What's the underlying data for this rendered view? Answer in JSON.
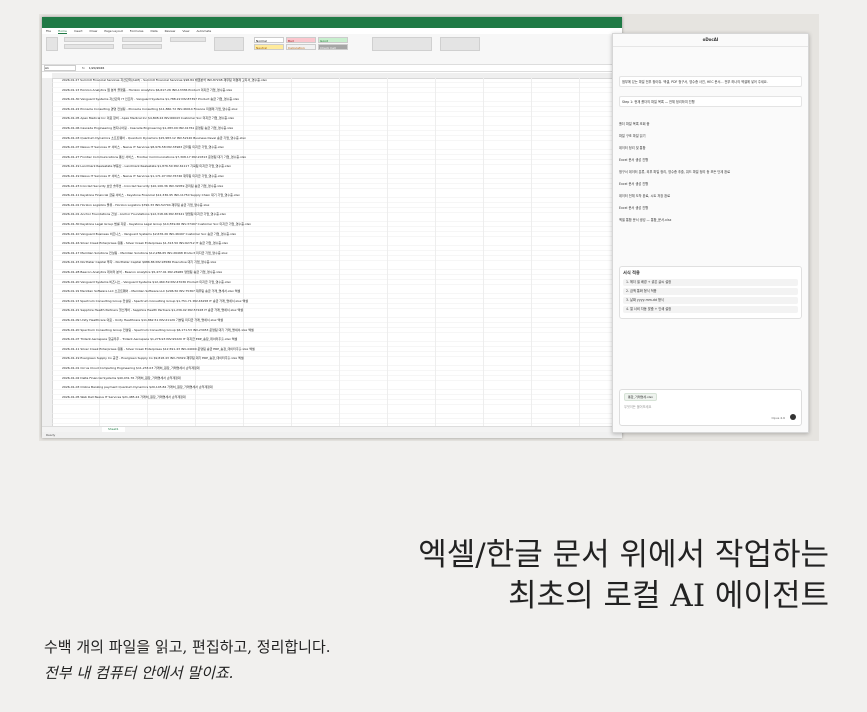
{
  "excel": {
    "ribbon_tabs": [
      "File",
      "Home",
      "Insert",
      "Draw",
      "Page Layout",
      "Formulas",
      "Data",
      "Review",
      "View",
      "Automate"
    ],
    "active_tab": "Home",
    "share_label": "Share",
    "comments_label": "Comments",
    "style_cells": [
      "Normal",
      "Bad",
      "Good",
      "Neutral",
      "Calculation",
      "Check Cell"
    ],
    "namebox": "A1",
    "formula_value": "1/20/2026",
    "sheet_tab": "Sheet1",
    "status": "Ready",
    "rows": [
      "2026.01.27   Summit Financial Services   자산관리(ALM) - Summit Financial Services   $98.84   채권분석   INV-87248   재무팀   미결제   고지서_영수증.xlsx",
      "2026.01.13   Horizon Analytics   웹 분석   플랫폼 - Horizon Analytics   $6,617.26   INV-13336   Product   미지급   기업_영수증.xlsx",
      "2026-01-30 Vanguard Systems   자산관리   IT 인프라 - Vanguard Systems   $1,788.22   INV-87397   Product   송금   기업_영수증.xlsx",
      "2026-01-22 Pinnacle Consulting   경영 컨설팅 - Pinnacle Consulting   $11,860.72   INV-46014   Finance   미결제   기업_영수증.xlsx",
      "2026-01-05 Apex Medical Inc   의료 장비 - Apex Medical Inc   $4,808.24   INV-66043   Customer Svc   미지급   기업_영수증.xlsx",
      "2026-01-06 Cascade Engineering   엔지니어링 - Cascade Engineering   $1,283.09   INV-41761   운영팀   송금   기업_영수증.xlsx",
      "2026-01-03 Quantum Dynamics   소프트웨어 - Quantum Dynamics   $15,983.12   INV-52120   Business Devel   송금   기업_영수증.xlsx",
      "2026-01-07 Nexus IT Services   IT 서비스 - Nexus IT Services   $8,976.58   INV-33963   관리팀   미지급   기업_영수증.xlsx",
      "2026-01-27 Frontier Communications   통신 서비스 - Frontier Communications   $7,308.17   INV-20313   운영팀   대기   기업_영수증.xlsx",
      "2026-01-19 Landmark Realestate   부동산 - Landmark Realestate   $1,876.50   INV-61117   기획팀   미지급   기업_영수증.xlsx",
      "2026-01-19 Nexus IT Services   IT 서비스 - Nexus IT Services   $1,171.97   INV-76746   재무팀   미지급   기업_영수증.xlsx",
      "2026-01-23 Ironclad Security   보안 솔루션 - Ironclad Security   $10,106.36   INV-32059   관리팀   송금   기업_영수증.xlsx",
      "2026-01-11 Keystone Financial   금융 서비스 - Keystone Financial   $12,336.95   INV-11750   Supply Chain   대기   기업_영수증.xlsx",
      "2026-01-01 Horizon Logistics   물류 - Horizon Logistics   $790.33   INV-52794   재무팀   송금   기업_영수증.xlsx",
      "2026-01-01 Anchor Foundations   건설 - Anchor Foundations   $12,318.96   INV-87441   영업팀   미지급   기업_영수증.xlsx",
      "2026-01-30 Keystone Legal Group   법률 자문 - Keystone Legal Group   $14,559.66   INV-37497   Customer Svc   미지급   기업_영수증.xlsx",
      "2026-01-10 Vanguard Business   비즈니스 - Vanguard Systems   $2,676.26   INV-46497   Customer Svc   송금   기업_영수증.xlsx",
      "2026-01-16 Silver Creek Enterprises   유통 - Silver Creek Enterprises   $1,313.50   INV-62712   IT   송금   기업_영수증.xlsx",
      "2026-01-17 Meridian Solutions   컨설팅 - Meridian Solutions   $12,286.65   INV-26468   Product   미지급   기업_영수증.xlsx",
      "2026-01-15 Northstar Capital   투자 - Northstar Capital   $686.86   INV-93586   Executive   대기   기업_영수증.xlsx",
      "2026-01-28 Beacon Analytics   데이터 분석 - Beacon Analytics   $5,477.91   INV-26965   영업팀   송금   기업_영수증.xlsx",
      "2026-01-20 Vanguard Systems   비즈니스 - Vanguard Systems   $12,460.59   INV-47036   Product   미지급   기업_영수증.xlsx",
      "2026.01.19   Meridian Software LLC   소프트웨어 - Meridian Software LLC   $296.50   INV-75367   재무팀   송금   거래_명세서.xlsx   엑셀",
      "2026.01.13   Spectrum Consulting Group   컨설팅 - Spectrum Consulting Group   $1,751.71   INV-46158   IT   송금   거래_명세서.xlsx   엑셀",
      "2026-01-21 Sapphire Health Partners   헬스케어 - Sapphire Health Partners   $1,236.02   INV-57228   IT   송금   거래_명세서.xlsx   엑셀",
      "2026-01-09 Unity Healthcare   의료 - Unity Healthcare   $11,862.51   INV-21129   기술팀   미지급   거래_명세서.xlsx   엑셀",
      "2026-01-20 Spectrum Consulting Group   컨설팅 - Spectrum Consulting Group   $6,171.53   INV-23453   운영팀   대기   거래_명세서.xlsx   엑셀",
      "2026-01-07 Trident Aerospace   항공우주 - Trident Aerospace   $1,276.93   INV-95220   IT   미지급   ERP_송장_데이터추출.xlsx   엑셀",
      "2026-01-11 Silver Creek Enterprises   유통 - Silver Creek Enterprises   $12,591.43   INV-44000   운영팀   송금   ERP_송장_데이터추출.xlsx   엑셀",
      "2026-01-19 Evergreen Supply Co   공급 - Evergreen Supply Co   $9,818.43   INV-79329   재무팀   대기   ERP_송장_데이터추출.xlsx   엑셀",
      "2026-01-01   Cirrus Cloud Computing Engineering   $11,233.03   거래처_원장_거래명세서   손익계정대",
      "2026-01-02   Delta Financial Systems   $40,031.76   거래처_원장_거래명세서   손익계정대",
      "2026-01-03   Online Banking payment Quantum Dynamics   $20,145.84   거래처_원장_거래명세서   손익계정대",
      "2026-01-05   Web Dell Nexus IT Services   $21,485.24   거래처_원장_거래명세서   손익계정대"
    ]
  },
  "copilot": {
    "title": "oDocAI",
    "request": "첨부에 있는 파일 전부 찾아줘. 엑셀, PDF 청구서, 영수증 사진, HEC 문서... 전부 하나의 엑셀에 넣어 주세요.",
    "step": "Step 1: 현재 폴더의 파일 목록 — 전체 정리하여 진행",
    "lines": [
      "폴더 파일 목록 조회 중",
      "파일 구조 파일 읽기",
      "데이터 정리 및 통합",
      "Excel 문서 생성 진행",
      "청구서 데이터 분류, 외부 파일 정리, 영수증 추출, 워드 파일 정리 등 모든 단계 완료",
      "Excel 문서 생성 진행",
      "데이터 전체 도착 완료, 시트 저장 완료",
      "Excel 문서 생성 진행",
      "엑셀 통합 문서 생성 — 통합_문서.xlsx"
    ],
    "card_title": "서식 적용",
    "card_items": [
      "1. 헤더 셀 배경 + 굵은 글씨 설정",
      "2. 금액 통화 형식 적용",
      "3. 날짜 yyyy-mm-dd 형식",
      "4. 열 너비 자동 맞춤 + 인쇄 설정"
    ],
    "attachment": "통합_거래명세.xlsx",
    "input_placeholder": "무엇이든 물어보세요",
    "model_label": "Opus 4.6"
  },
  "headline": [
    "엑셀/한글 문서 위에서 작업하는",
    "최초의 로컬 AI 에이전트"
  ],
  "subline1": "수백 개의 파일을 읽고, 편집하고, 정리합니다.",
  "subline2": "전부 내 컴퓨터 안에서 말이죠."
}
